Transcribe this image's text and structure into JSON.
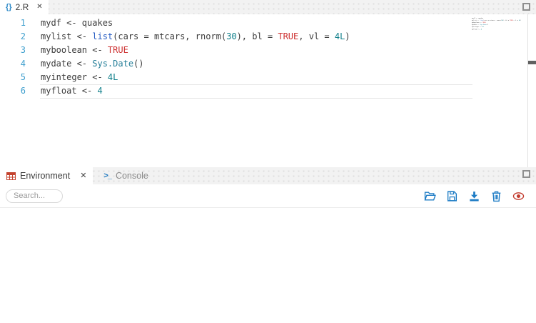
{
  "editor": {
    "tab": {
      "icon": "{}",
      "label": "2.R",
      "close": "✕"
    },
    "lines": [
      {
        "number": "1",
        "tokens": [
          [
            "mydf <- quakes",
            "plain"
          ]
        ]
      },
      {
        "number": "2",
        "tokens": [
          [
            "mylist <- ",
            "plain"
          ],
          [
            "list",
            "func"
          ],
          [
            "(cars = mtcars, rnorm(",
            "plain"
          ],
          [
            "30",
            "num"
          ],
          [
            "), bl = ",
            "plain"
          ],
          [
            "TRUE",
            "bool"
          ],
          [
            ", vl = ",
            "plain"
          ],
          [
            "4L",
            "num"
          ],
          [
            ")",
            "plain"
          ]
        ]
      },
      {
        "number": "3",
        "tokens": [
          [
            "myboolean <- ",
            "plain"
          ],
          [
            "TRUE",
            "bool"
          ]
        ]
      },
      {
        "number": "4",
        "tokens": [
          [
            "mydate <- ",
            "plain"
          ],
          [
            "Sys.Date",
            "type"
          ],
          [
            "()",
            "plain"
          ]
        ]
      },
      {
        "number": "5",
        "tokens": [
          [
            "myinteger <- ",
            "plain"
          ],
          [
            "4L",
            "num"
          ]
        ]
      },
      {
        "number": "6",
        "tokens": [
          [
            "myfloat <- ",
            "plain"
          ],
          [
            "4",
            "num"
          ]
        ]
      }
    ],
    "current_line": 6
  },
  "panel": {
    "tabs": [
      {
        "label": "Environment",
        "close": "✕"
      },
      {
        "label": "Console",
        "icon": ">_"
      }
    ],
    "search": {
      "placeholder": "Search..."
    },
    "actions": [
      "open-folder",
      "save",
      "import-data",
      "delete",
      "show-hidden-objects"
    ]
  },
  "colors": {
    "accent_blue": "#1e7cc5",
    "icon_red": "#c23b2e",
    "env_icon_red": "#c4432f",
    "line_number": "#3f9fce",
    "keyword_red": "#cd3131",
    "function_blue": "#2a5fc4",
    "number_teal": "#0f7f8a",
    "type_teal": "#267f99"
  }
}
